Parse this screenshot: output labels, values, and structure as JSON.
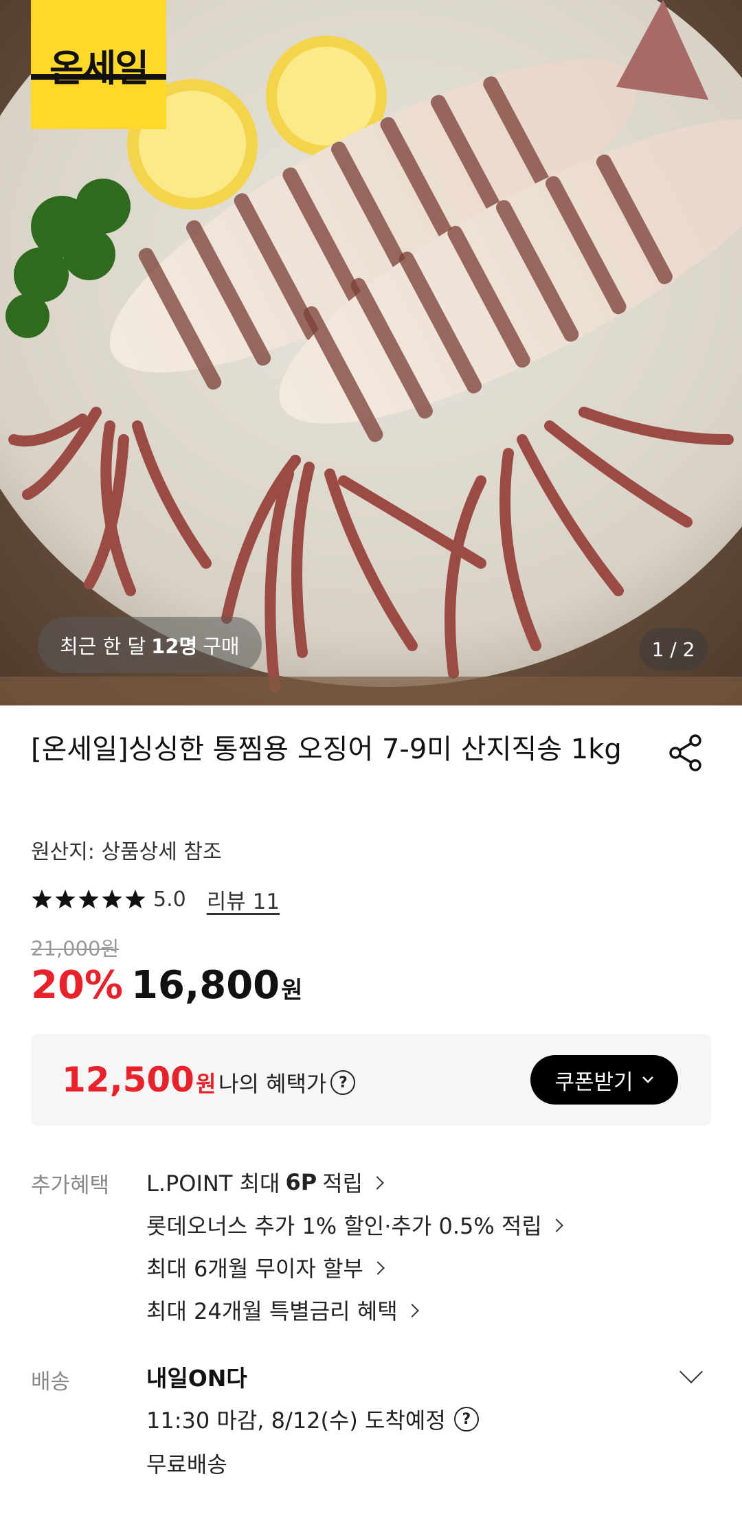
{
  "hero": {
    "brand": "온세일",
    "recent_buy_prefix": "최근 한 달",
    "recent_buy_count": "12명",
    "recent_buy_suffix": "구매",
    "pager": "1 / 2"
  },
  "product": {
    "title": "[온세일]싱싱한 통찜용 오징어 7-9미 산지직송 1kg",
    "origin": "원산지: 상품상세 참조",
    "rating": 5.0,
    "rating_text": "5.0",
    "stars": 5,
    "review_label": "리뷰 11",
    "original_price": "21,000원",
    "discount": "20%",
    "sale_price": "16,800",
    "currency": "원"
  },
  "benefit": {
    "price": "12,500",
    "currency": "원",
    "label": "나의 혜택가",
    "help": "?",
    "coupon_button": "쿠폰받기"
  },
  "extra": {
    "label": "추가혜택",
    "items": [
      {
        "pre": "L.POINT 최대",
        "bold": "6P",
        "post": "적립"
      },
      {
        "pre": "롯데오너스 추가 1% 할인·추가 0.5% 적립",
        "bold": "",
        "post": ""
      },
      {
        "pre": "최대 6개월 무이자 할부",
        "bold": "",
        "post": ""
      },
      {
        "pre": "최대 24개월 특별금리 혜택",
        "bold": "",
        "post": ""
      }
    ]
  },
  "delivery": {
    "label": "배송",
    "title": "내일ON다",
    "eta": "11:30 마감, 8/12(수) 도착예정",
    "help": "?",
    "fee": "무료배송"
  },
  "colors": {
    "accent_red": "#e8222b",
    "brand_yellow": "#ffd829",
    "benefit_bg": "#f6f6f6"
  }
}
